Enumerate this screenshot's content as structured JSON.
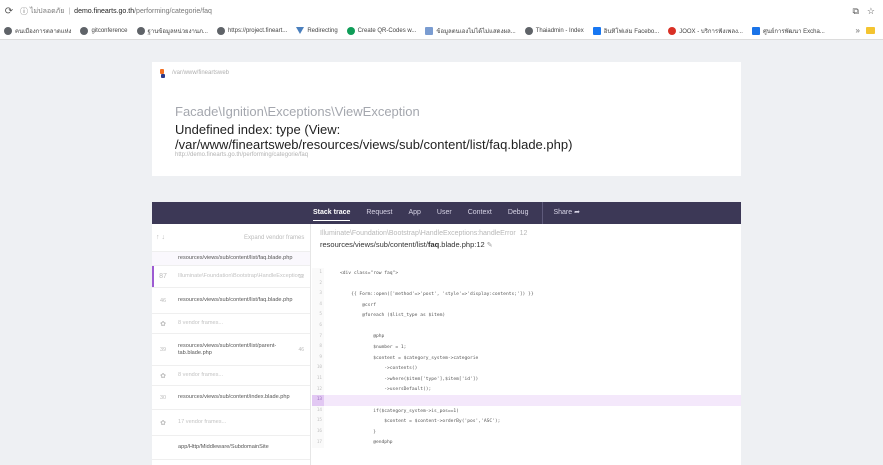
{
  "browser": {
    "reload_icon": "reload-icon",
    "security_label": "ไม่ปลอดภัย",
    "url_host": "demo.finearts.go.th",
    "url_path": "/performing/categorie/faq",
    "extensions_icon": "extensions-icon",
    "star_icon": "star-icon"
  },
  "bookmarks": [
    {
      "label": "คนเมืองการตลาดแห่ง",
      "icon": "globe-icon"
    },
    {
      "label": "gitconference",
      "icon": "globe-icon"
    },
    {
      "label": "ฐานข้อมูลหน่วยงานภ...",
      "icon": "globe-icon"
    },
    {
      "label": "https://project.fineart...",
      "icon": "globe-icon"
    },
    {
      "label": "Redirecting",
      "icon": "funnel-icon"
    },
    {
      "label": "Create QR-Codes w...",
      "icon": "qr-icon"
    },
    {
      "label": "ข้อมูลตนเองไม่ได้ไม่แสดงผล...",
      "icon": "doc-icon"
    },
    {
      "label": "Thaiadmin - Index",
      "icon": "globe-icon"
    },
    {
      "label": "อินทิโฟเล่ม Facebo...",
      "icon": "facebook-icon"
    },
    {
      "label": "JOOX - บริการฟังเพลง...",
      "icon": "joox-icon"
    },
    {
      "label": "ศูนย์การพัฒนา Excha...",
      "icon": "exchange-icon"
    }
  ],
  "error": {
    "crumb": "/var/www/fineartsweb",
    "exception_class": "Facade\\Ignition\\Exceptions\\ViewException",
    "message": "Undefined index: type (View: /var/www/fineartsweb/resources/views/sub/content/list/faq.blade.php)",
    "url": "http://demo.finearts.go.th/performing/categorie/faq"
  },
  "tabs": {
    "stack_trace": "Stack trace",
    "request": "Request",
    "app": "App",
    "user": "User",
    "context": "Context",
    "debug": "Debug",
    "share": "Share"
  },
  "frames_header": {
    "arrows": "↑ ↓",
    "expand_label": "Expand vendor frames"
  },
  "frames": [
    {
      "num": "",
      "text": "resources/views/sub/content/list/faq.blade.php",
      "line": ""
    },
    {
      "num": "87",
      "text": "Illuminate\\Foundation\\Bootstrap\\HandleExceptions",
      "line": "12"
    },
    {
      "num": "46",
      "text": "resources/views/sub/content/list/faq.blade.php",
      "line": ""
    },
    {
      "num": "✿",
      "text": "8 vendor frames...",
      "line": ""
    },
    {
      "num": "39",
      "text": "resources/views/sub/content/list/parent-tab.blade.php",
      "line": "46"
    },
    {
      "num": "✿",
      "text": "8 vendor frames...",
      "line": ""
    },
    {
      "num": "30",
      "text": "resources/views/sub/content/index.blade.php",
      "line": ""
    },
    {
      "num": "✿",
      "text": "17 vendor frames...",
      "line": ""
    },
    {
      "num": "",
      "text": "app/Http/Middleware/SubdomainSite",
      "line": ""
    }
  ],
  "code": {
    "class": "Illuminate\\Foundation\\Bootstrap\\HandleExceptions:handleError",
    "class_line": "12",
    "file_path": "resources/views/sub/content/list/",
    "file_name": "faq",
    "file_ext": ".blade.php:12",
    "lines": [
      {
        "n": "1",
        "t": "<div class=\"row faq\">"
      },
      {
        "n": "2",
        "t": ""
      },
      {
        "n": "3",
        "t": "    {{ Form::open(['method'=>'post', 'style'=>'display:contents;']) }}"
      },
      {
        "n": "4",
        "t": "        @csrf"
      },
      {
        "n": "5",
        "t": "        @foreach ($list_type as $item)"
      },
      {
        "n": "6",
        "t": ""
      },
      {
        "n": "7",
        "t": "            @php"
      },
      {
        "n": "8",
        "t": "            $number = 1;"
      },
      {
        "n": "9",
        "t": "            $content = $category_system->categorie"
      },
      {
        "n": "10",
        "t": "                ->contents()"
      },
      {
        "n": "11",
        "t": "                ->where($item['type'],$item['id'])"
      },
      {
        "n": "12",
        "t": "                ->usersDefault();"
      },
      {
        "n": "13",
        "t": ""
      },
      {
        "n": "14",
        "t": "            if($category_system->is_pos==1)"
      },
      {
        "n": "15",
        "t": "                $content = $content->orderBy('pos','ASC');"
      },
      {
        "n": "16",
        "t": "            }"
      },
      {
        "n": "17",
        "t": "            @endphp"
      }
    ]
  },
  "colors": {
    "tab_bar": "#3c3856",
    "highlight": "#f4e8fb",
    "accent": "#9d5bd2"
  }
}
